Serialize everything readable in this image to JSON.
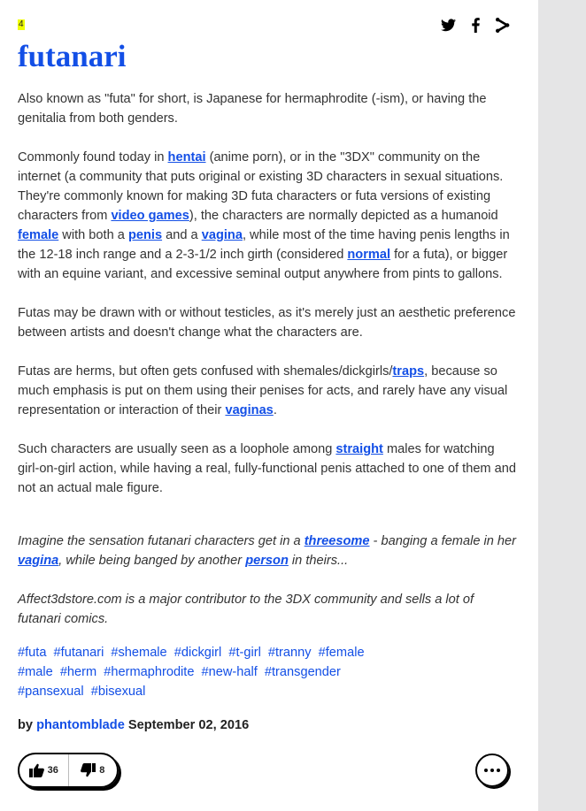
{
  "rank": "4",
  "share": {
    "twitter_icon": "twitter-icon",
    "facebook_icon": "facebook-icon",
    "share_icon": "share-icon"
  },
  "word": "futanari",
  "meaning": {
    "p1": "Also known as \"futa\" for short, is Japanese for hermaphrodite (-ism), or having the genitalia from both genders.",
    "p2": {
      "t1": "Commonly found today in ",
      "l1": "hentai",
      "t2": " (anime porn), or in the \"3DX\" community on the internet (a community that puts original or existing 3D characters in sexual situations. They're commonly known for making 3D futa characters or futa versions of existing characters from ",
      "l2": "video games",
      "t3": "), the characters are normally depicted as a humanoid ",
      "l3": "female",
      "t4": " with both a ",
      "l4": "penis",
      "t5": " and a ",
      "l5": "vagina",
      "t6": ", while most of the time having penis lengths in the 12-18 inch range and a 2-3-1/2 inch girth (considered ",
      "l6": "normal",
      "t7": " for a futa), or bigger with an equine variant, and excessive seminal output anywhere from pints to gallons."
    },
    "p3": "Futas may be drawn with or without testicles, as it's merely just an aesthetic preference between artists and doesn't change what the characters are.",
    "p4": {
      "t1": "Futas are herms, but often gets confused with shemales/dickgirls/",
      "l1": "traps",
      "t2": ", because so much emphasis is put on them using their penises for acts, and rarely have any visual representation or interaction of their ",
      "l2": "vaginas",
      "t3": "."
    },
    "p5": {
      "t1": "Such characters are usually seen as a loophole among ",
      "l1": "straight",
      "t2": " males for watching girl-on-girl action, while having a real, fully-functional penis attached to one of them and not an actual male figure."
    }
  },
  "example": {
    "p1": {
      "t1": "Imagine the sensation futanari characters get in a ",
      "l1": "threesome",
      "t2": " - banging a female in her ",
      "l2": "vagina",
      "t3": ", while being banged by another ",
      "l3": "person",
      "t4": " in theirs..."
    },
    "p2": "Affect3dstore.com is a major contributor to the 3DX community and sells a lot of futanari comics."
  },
  "tags": [
    "#futa",
    "#futanari",
    "#shemale",
    "#dickgirl",
    "#t-girl",
    "#tranny",
    "#female",
    "#male",
    "#herm",
    "#hermaphrodite",
    "#new-half",
    "#transgender",
    "#pansexual",
    "#bisexual"
  ],
  "byline": {
    "by": "by",
    "author": "phantomblade",
    "date": "September 02, 2016"
  },
  "votes": {
    "up": "36",
    "down": "8",
    "up_icon": "thumbs-up-icon",
    "down_icon": "thumbs-down-icon"
  },
  "more_icon": "more-options-icon",
  "colors": {
    "link": "#134fe6",
    "rank_highlight": "#efff00",
    "sidebar": "#e5e5e6"
  }
}
